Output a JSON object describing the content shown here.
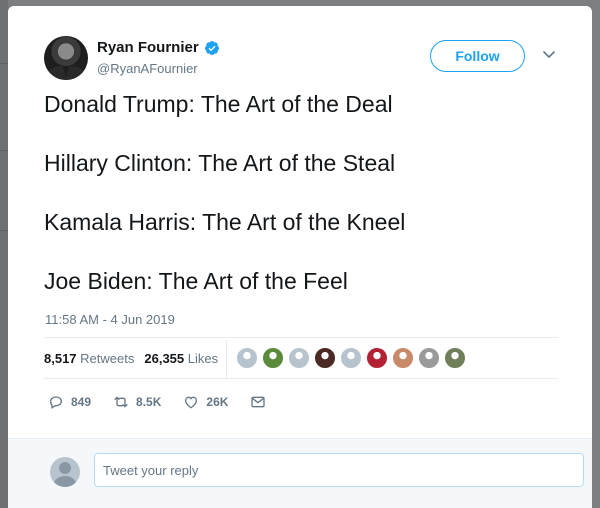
{
  "author": {
    "display_name": "Ryan Fournier",
    "handle": "@RyanAFournier",
    "verified": true
  },
  "follow_label": "Follow",
  "tweet_lines": [
    "Donald Trump: The Art of the Deal",
    "Hillary Clinton: The Art of the Steal",
    "Kamala Harris: The Art of the Kneel",
    "Joe Biden: The Art of the Feel"
  ],
  "timestamp": "11:58 AM - 4 Jun 2019",
  "stats": {
    "retweets_count": "8,517",
    "retweets_label": "Retweets",
    "likes_count": "26,355",
    "likes_label": "Likes"
  },
  "likers": [
    {
      "icon": "default-avatar",
      "color": "#b8c4cd"
    },
    {
      "icon": "eagle-avatar",
      "color": "#5a8a3a"
    },
    {
      "icon": "default-avatar",
      "color": "#b8c4cd"
    },
    {
      "icon": "dark-avatar",
      "color": "#4a2a22"
    },
    {
      "icon": "default-avatar",
      "color": "#b8c4cd"
    },
    {
      "icon": "flag-avatar",
      "color": "#b22234"
    },
    {
      "icon": "person-avatar",
      "color": "#c98a6a"
    },
    {
      "icon": "gray-avatar",
      "color": "#9a9a9a"
    },
    {
      "icon": "green-avatar",
      "color": "#6f7f5a"
    }
  ],
  "actions": {
    "reply_count": "849",
    "retweet_count": "8.5K",
    "like_count": "26K"
  },
  "reply": {
    "placeholder": "Tweet your reply"
  },
  "colors": {
    "accent": "#1da1f2",
    "secondary_text": "#657786",
    "primary_text": "#14171a"
  }
}
